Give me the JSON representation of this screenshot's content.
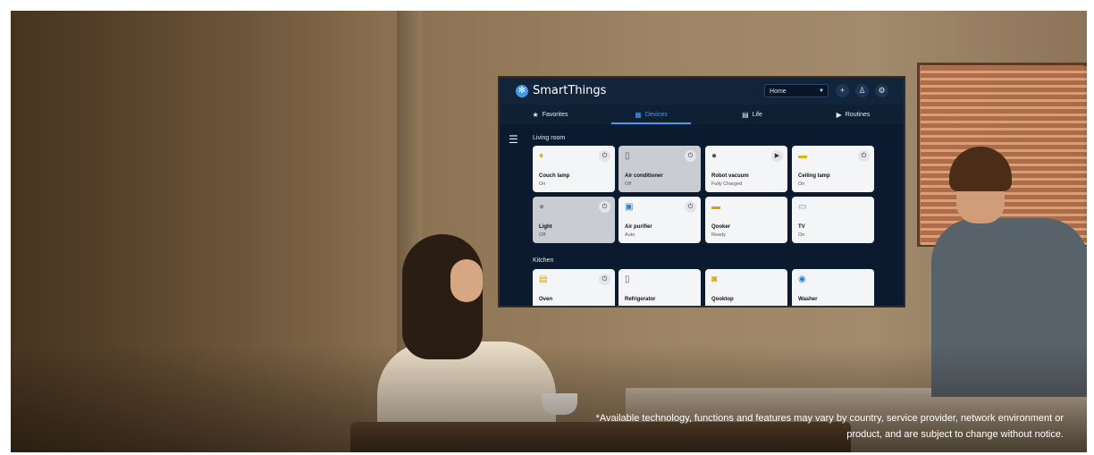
{
  "tv": {
    "app_title": "SmartThings",
    "home_select": "Home",
    "tabs": [
      {
        "label": "Favorites",
        "icon": "star-icon"
      },
      {
        "label": "Devices",
        "icon": "devices-grid-icon"
      },
      {
        "label": "Life",
        "icon": "life-icon"
      },
      {
        "label": "Routines",
        "icon": "play-icon"
      }
    ],
    "active_tab": "Devices",
    "sections": [
      {
        "title": "Living room",
        "devices": [
          {
            "name": "Couch lamp",
            "status": "On"
          },
          {
            "name": "Air conditioner",
            "status": "Off"
          },
          {
            "name": "Robot vacuum",
            "status": "Fully Charged"
          },
          {
            "name": "Ceiling lamp",
            "status": "On"
          },
          {
            "name": "Light",
            "status": "Off"
          },
          {
            "name": "Air purifier",
            "status": "Auto"
          },
          {
            "name": "Qooker",
            "status": "Ready"
          },
          {
            "name": "TV",
            "status": "On"
          }
        ]
      },
      {
        "title": "Kitchen",
        "devices": [
          {
            "name": "Oven",
            "status": ""
          },
          {
            "name": "Refrigerator",
            "status": ""
          },
          {
            "name": "Qooktop",
            "status": ""
          },
          {
            "name": "Washer",
            "status": ""
          }
        ]
      }
    ]
  },
  "disclaimer": {
    "line1": "*Available technology, functions and features may vary by country, service provider, network environment or",
    "line2": "product, and are subject to change without notice."
  },
  "colors": {
    "accent": "#3aa0ef",
    "tv_background": "#0b1a2e"
  }
}
